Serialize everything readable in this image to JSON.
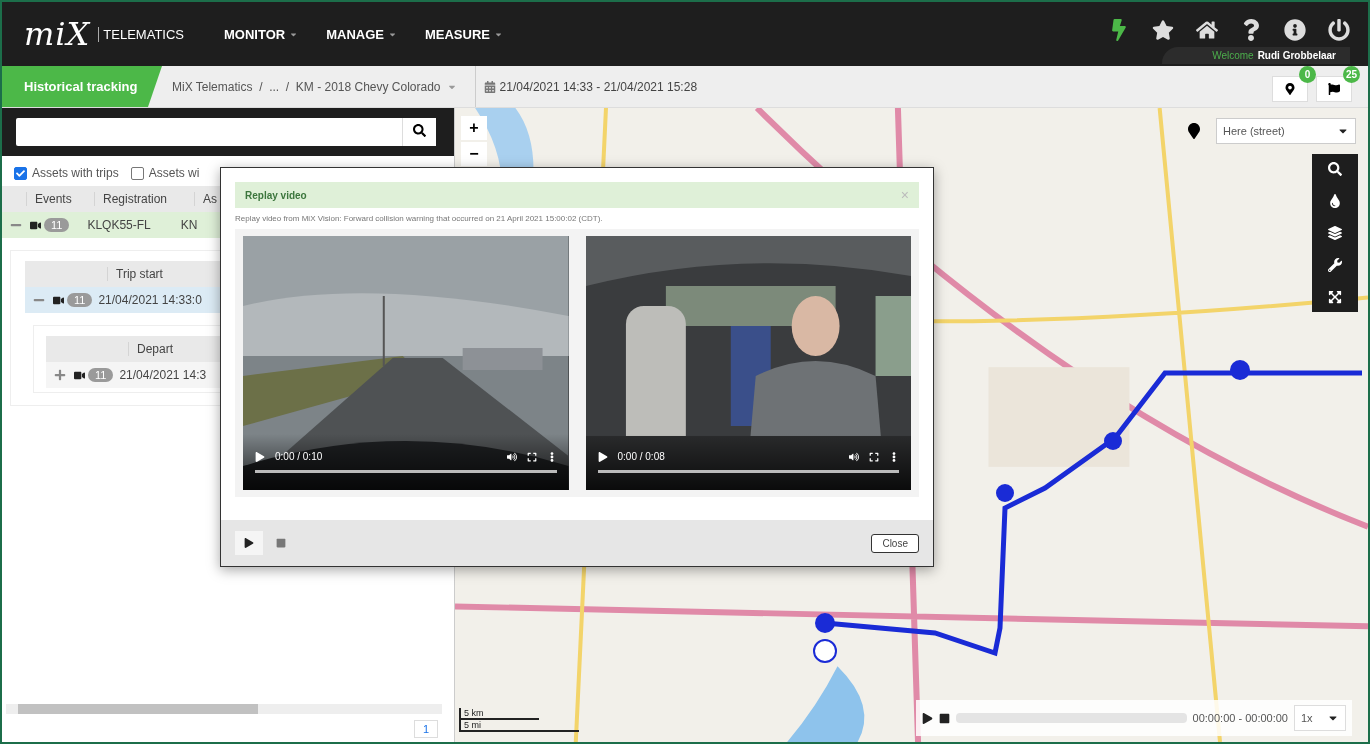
{
  "header": {
    "logo": "miX",
    "logo_sub": "TELEMATICS",
    "menu": [
      {
        "label": "MONITOR"
      },
      {
        "label": "MANAGE"
      },
      {
        "label": "MEASURE"
      }
    ],
    "welcome_label": "Welcome",
    "user": "Rudi Grobbelaar"
  },
  "subbar": {
    "title": "Historical tracking",
    "breadcrumb": "MiX Telematics  /  ...  /  KM - 2018 Chevy Colorado",
    "date_range": "21/04/2021 14:33 - 21/04/2021 15:28",
    "badges": [
      {
        "kind": "pin",
        "count": "0"
      },
      {
        "kind": "flag",
        "count": "25"
      }
    ]
  },
  "left_panel": {
    "filters": [
      {
        "label": "Assets with trips",
        "checked": true
      },
      {
        "label": "Assets wi",
        "checked": false
      }
    ],
    "assets": {
      "columns": [
        "Events",
        "Registration",
        "As"
      ],
      "row": {
        "expanded": true,
        "count": "11",
        "registration": "KLQK55-FL",
        "column_3": "KN"
      }
    },
    "trips": {
      "columns": [
        "Trip start"
      ],
      "row": {
        "expanded": true,
        "count": "11",
        "trip_start": "21/04/2021 14:33:0"
      }
    },
    "segments": {
      "columns": [
        "Depart"
      ],
      "row": {
        "expanded": false,
        "count": "11",
        "depart": "21/04/2021 14:3"
      }
    },
    "page": "1"
  },
  "map": {
    "zoom": [
      "+",
      "−"
    ],
    "layer": "Here (street)",
    "scale": [
      "5 km",
      "5 mi"
    ],
    "playback": {
      "level": 0,
      "time": "00:00:00 - 00:00:00"
    },
    "speed": "1x"
  },
  "modal": {
    "title": "Replay video",
    "close_symbol": "×",
    "description": "Replay video from MiX Vision: Forward collision warning that occurred on 21 April 2021 15:00:02 (CDT).",
    "videos": [
      {
        "time": "0:00 / 0:10",
        "level": 0
      },
      {
        "time": "0:00 / 0:08",
        "level": 0
      }
    ],
    "close_button": "Close"
  }
}
